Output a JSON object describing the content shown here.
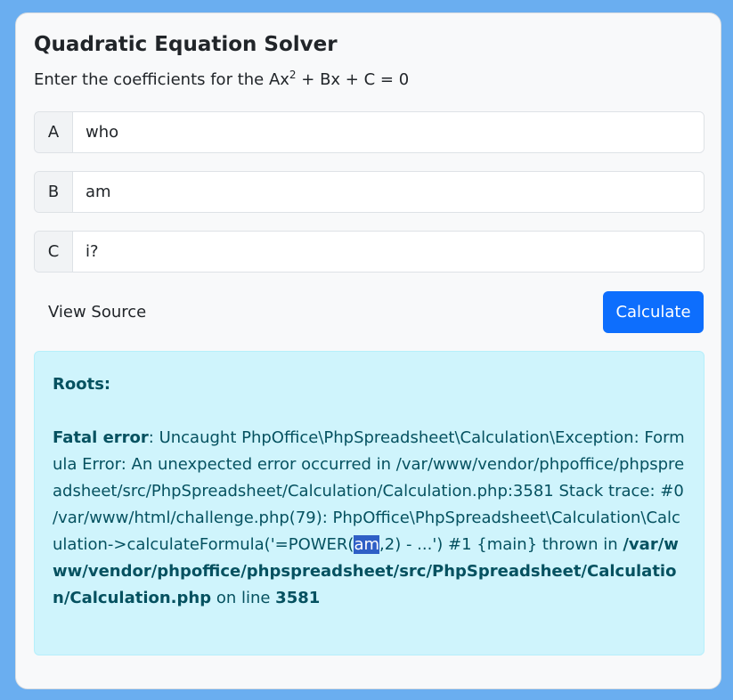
{
  "header": {
    "title": "Quadratic Equation Solver",
    "subtitle_prefix": "Enter the coefficients for the Ax",
    "subtitle_sup": "2",
    "subtitle_suffix": " + Bx + C = 0"
  },
  "inputs": [
    {
      "label": "A",
      "value": "who"
    },
    {
      "label": "B",
      "value": "am"
    },
    {
      "label": "C",
      "value": "i?"
    }
  ],
  "actions": {
    "view_source_label": "View Source",
    "calculate_label": "Calculate"
  },
  "result": {
    "roots_label": "Roots:",
    "error_title": "Fatal error",
    "error_message_before": ": Uncaught PhpOffice\\PhpSpreadsheet\\Calculation\\Exception: Formula Error: An unexpected error occurred in /var/www/vendor/phpoffice/phpspreadsheet/src/PhpSpreadsheet/Calculation/Calculation.php:3581 Stack trace: #0 /var/www/html/challenge.php(79): PhpOffice\\PhpSpreadsheet\\Calculation\\Calculation->calculateFormula('=POWER(",
    "error_highlight": "am",
    "error_message_after": ",2) - ...') #1 {main} thrown in ",
    "error_file": "/var/www/vendor/phpoffice/phpspreadsheet/src/PhpSpreadsheet/Calculation/Calculation.php",
    "on_line_text": " on line ",
    "line_number": "3581"
  },
  "colors": {
    "page_background": "#6aaef0",
    "primary_button": "#0d6efd",
    "alert_background": "#cff4fc",
    "alert_text": "#055160",
    "selection_highlight": "#2f5fc6"
  }
}
